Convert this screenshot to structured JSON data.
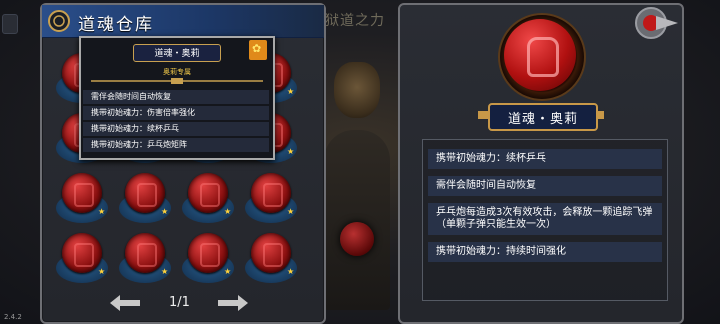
{
  "version": "2.4.2",
  "background_title": "狱道之力",
  "storage": {
    "title": "道魂仓库",
    "pager": {
      "page": "1/1"
    },
    "slots": [
      {
        "star": "★"
      },
      {
        "star": "★"
      },
      {
        "star": "★"
      },
      {
        "star": "★"
      },
      {
        "star": "★"
      },
      {
        "star": "★"
      },
      {
        "star": "★"
      },
      {
        "star": "★"
      },
      {
        "star": "★"
      },
      {
        "star": "★"
      },
      {
        "star": "★"
      },
      {
        "star": "★"
      },
      {
        "star": "★"
      },
      {
        "star": "★"
      },
      {
        "star": "★"
      },
      {
        "star": "★"
      }
    ]
  },
  "tooltip": {
    "name": "道魂・奥莉",
    "subtitle": "奥莉专属",
    "lines": [
      "需伴会随时间自动恢复",
      "携带初始魂力：伤害倍率强化",
      "携带初始魂力：续杯乒乓",
      "携带初始魂力：乒乓炮矩阵"
    ]
  },
  "detail": {
    "name": "道魂・奥莉",
    "lines": [
      "携带初始魂力：续杯乒乓",
      "需伴会随时间自动恢复",
      "乒乓炮每造成3次有效攻击，会释放一颗追踪飞弹（单颗子弹只能生效一次）",
      "携带初始魂力：持续时间强化"
    ]
  },
  "colors": {
    "title_bar": "#1c3766",
    "orb_red": "#b01010",
    "star_gold": "#ffd23a",
    "frame_gold": "#c89848"
  },
  "icons": {
    "close": "close-icon",
    "prev": "arrow-left-icon",
    "next": "arrow-right-icon",
    "emblem": "gear-emblem-icon"
  }
}
